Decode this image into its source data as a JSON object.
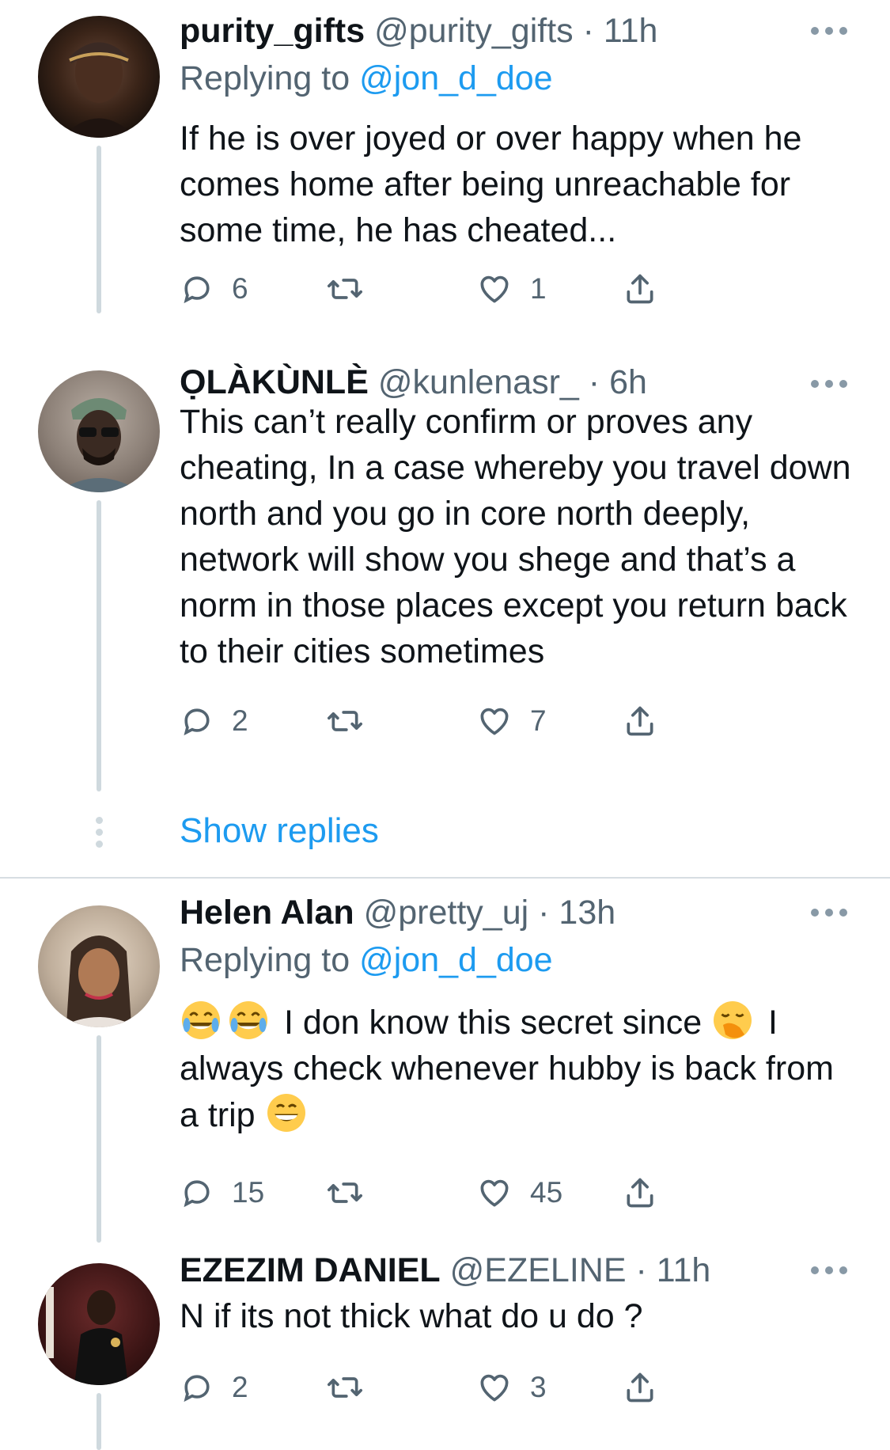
{
  "tweets": [
    {
      "name": "purity_gifts",
      "handle": "@purity_gifts",
      "time": "11h",
      "replying_prefix": "Replying to ",
      "replying_to": "@jon_d_doe",
      "text": "If he is over joyed or over happy when he comes home after being unreachable for some time, he has cheated...",
      "replies": "6",
      "retweets": "",
      "likes": "1",
      "avatar_colors": [
        "#2a1a12",
        "#6b4a3a"
      ]
    },
    {
      "name": "ỌLÀKÙNLÈ",
      "handle": "@kunlenasr_",
      "time": "6h",
      "text": "This can’t really confirm or proves any cheating, In a case whereby you travel down north and you go in core north deeply, network will show you shege and that’s a norm in those places except you return back to their cities sometimes",
      "replies": "2",
      "retweets": "",
      "likes": "7",
      "avatar_colors": [
        "#9a8f86",
        "#3b2e28"
      ]
    },
    {
      "name": "Helen Alan",
      "handle": "@pretty_uj",
      "time": "13h",
      "replying_prefix": "Replying to ",
      "replying_to": "@jon_d_doe",
      "text_part1": " I don know this secret since ",
      "text_part2": " I always check whenever hubby is back from a trip ",
      "replies": "15",
      "retweets": "",
      "likes": "45",
      "avatar_colors": [
        "#c9b9a6",
        "#5a4a3e"
      ]
    },
    {
      "name": "EZEZIM DANIEL",
      "handle": "@EZELINE",
      "time": "11h",
      "text": "N if its not thick what do u do ?",
      "replies": "2",
      "retweets": "",
      "likes": "3",
      "avatar_colors": [
        "#7a1e1e",
        "#1a1a1a"
      ]
    }
  ],
  "separator": "·",
  "show_replies": "Show replies",
  "icons": {
    "reply": "reply-icon",
    "retweet": "retweet-icon",
    "like": "like-icon",
    "share": "share-icon",
    "more": "more-icon"
  },
  "colors": {
    "accent": "#1d9bf0",
    "icon": "#536471",
    "thread": "#cfd9de"
  }
}
